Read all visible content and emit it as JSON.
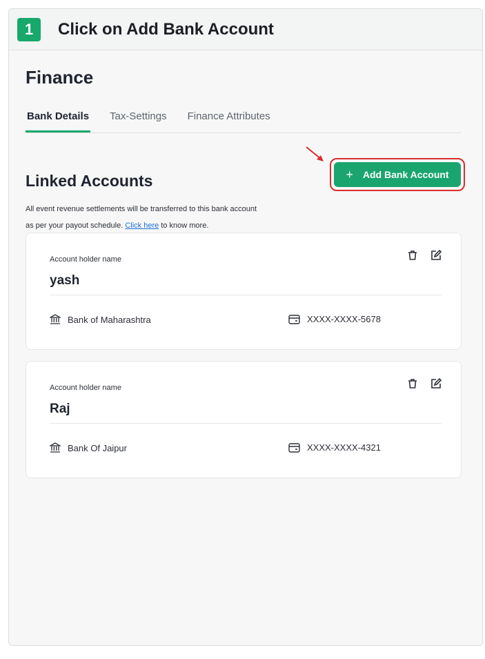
{
  "step": {
    "number": "1",
    "title": "Click on Add Bank Account"
  },
  "page": {
    "title": "Finance"
  },
  "tabs": [
    {
      "label": "Bank Details",
      "active": true
    },
    {
      "label": "Tax-Settings",
      "active": false
    },
    {
      "label": "Finance Attributes",
      "active": false
    }
  ],
  "linked": {
    "title": "Linked Accounts",
    "add_button_label": "Add Bank Account",
    "description_line1": "All event revenue settlements will be transferred to this bank account",
    "description_line2_before": "as per your payout schedule.",
    "description_link": "Click here",
    "description_line2_after": "to know more."
  },
  "accounts": [
    {
      "holder_label": "Account holder name",
      "holder_name": "yash",
      "bank": "Bank of Maharashtra",
      "account": "XXXX-XXXX-5678"
    },
    {
      "holder_label": "Account holder name",
      "holder_name": "Raj",
      "bank": "Bank Of Jaipur",
      "account": "XXXX-XXXX-4321"
    }
  ],
  "colors": {
    "accent": "#17a86b",
    "highlight": "#d92c2c",
    "link": "#1f6fd6"
  }
}
